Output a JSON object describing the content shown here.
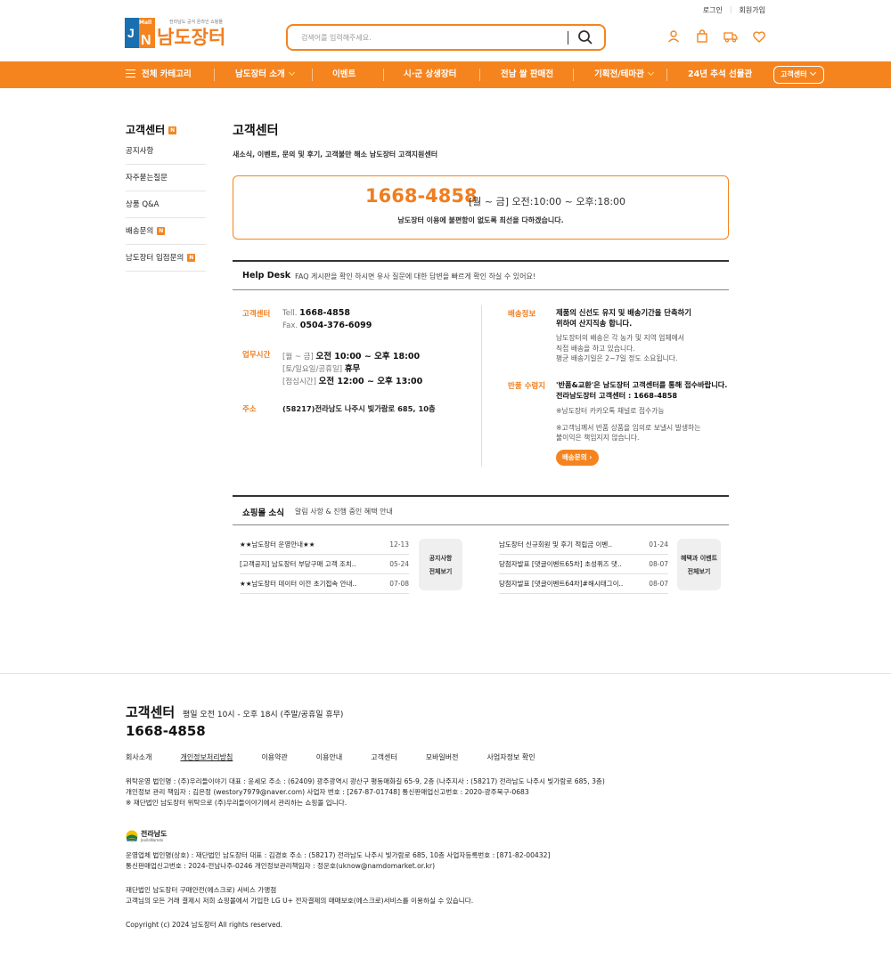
{
  "header": {
    "login": "로그인",
    "signup": "회원가입",
    "logo_text": "남도장터",
    "logo_tag": "전라남도 공식 온라인 쇼핑몰",
    "logo_mark": "Mall",
    "search_placeholder": "검색어를 입력해주세요."
  },
  "nav": {
    "all_category": "전체 카테고리",
    "items": [
      "남도장터 소개",
      "이벤트",
      "시·군 상생장터",
      "전남 쌀 판매전",
      "기획전/테마관",
      "24년 추석 선물관"
    ],
    "cs_button": "고객센터"
  },
  "sidebar": {
    "title": "고객센터",
    "badge": "N",
    "items": [
      "공지사항",
      "자주묻는질문",
      "상품 Q&A",
      "배송문의",
      "남도장터 입점문의"
    ]
  },
  "main": {
    "title": "고객센터",
    "subtitle": "새소식, 이벤트, 문의 및 후기, 고객불만 해소 남도장터 고객지원센터",
    "phone": "1668-4858",
    "hours": "[월 ~ 금] 오전:10:00 ~ 오후:18:00",
    "message": "남도장터 이용에 불편함이 없도록 최선을 다하겠습니다."
  },
  "helpdesk": {
    "title": "Help Desk",
    "desc": "FAQ 게시판을 확인 하시면 유사 질문에 대한 답변을 빠르게 확인 하실 수 있어요!",
    "cs_label": "고객센터",
    "tel_label": "Tell.",
    "tel": "1668-4858",
    "fax_label": "Fax.",
    "fax": "0504-376-6099",
    "work_label": "업무시간",
    "work1_label": "[월 ~ 금]",
    "work1": "오전 10:00 ~ 오후 18:00",
    "work2_label": "[토/일요일/공휴일]",
    "work2": "휴무",
    "work3_label": "[점심시간]",
    "work3": "오전 12:00 ~ 오후 13:00",
    "addr_label": "주소",
    "addr": "(58217)전라남도 나주시 빛가람로 685, 10층",
    "ship_label": "배송정보",
    "ship_title1": "제품의 신선도 유지 및 배송기간을 단축하기",
    "ship_title2": "위하여 산지직송 합니다.",
    "ship_text1": "남도장터의 배송은 각 농가 및 지역 업체에서",
    "ship_text2": "직접 배송을 하고 있습니다.",
    "ship_text3": "평균 배송기일은 2~7일 정도 소요됩니다.",
    "return_label": "반품 수령지",
    "return_title1": "'반품&교환'은 남도장터 고객센터를 통해 접수바랍니다.",
    "return_title2": "전라남도장터 고객센터 : 1668-4858",
    "return_text1": "※남도장터 카카오톡 채널로 접수가능",
    "return_text2": "※고객님께서 반품 상품을 임의로 보낼시 발생하는",
    "return_text3": "불이익은 책임지지 않습니다.",
    "ship_button": "배송문의"
  },
  "news": {
    "title": "쇼핑몰 소식",
    "desc": "알림 사항 & 진행 중인 혜택 안내",
    "notices": [
      {
        "title": "★★남도장터 운영안내★★",
        "date": "12-13"
      },
      {
        "title": "[고객공지] 남도장터 부당구매 고객 조치..",
        "date": "05-24"
      },
      {
        "title": "★★남도장터 데이터 이전 초기접속 안내..",
        "date": "07-08"
      }
    ],
    "notice_btn1": "공지사항",
    "notice_btn2": "전체보기",
    "events": [
      {
        "title": "남도장터 신규회원 및 후기 적립금 이벤..",
        "date": "01-24"
      },
      {
        "title": "당첨자발표 [댓글이벤트65차] 초성퀴즈 댓..",
        "date": "08-07"
      },
      {
        "title": "당첨자발표 [댓글이벤트64차]#해시태그이..",
        "date": "08-07"
      }
    ],
    "event_btn1": "혜택과 이벤트",
    "event_btn2": "전체보기"
  },
  "footer": {
    "cs_title": "고객센터",
    "cs_hours": "평일 오전 10시 - 오후 18시 (주말/공휴일 휴무)",
    "cs_tel": "1668-4858",
    "links": [
      "회사소개",
      "개인정보처리방침",
      "이용약관",
      "이용안내",
      "고객센터",
      "모바일버전",
      "사업자정보 확인"
    ],
    "line1": "위탁운영 법인명 : (주)우리들이야기      대표 : 윤세모      주소 : (62409) 광주광역시 광산구 평동매화길 65-9, 2층 (나주지사 : (58217) 전라남도 나주시 빛가람로 685, 3층)",
    "line2": "개인정보 관리 책임자 : 김은정 (westory7979@naver.com)    사업자 번호 : [267-87-01748]   통신판매업신고번호 : 2020-광주북구-0683",
    "line3": "※ 재단법인 남도장터 위탁으로 (주)우리들이야기에서 관리하는 쇼핑몰 입니다.",
    "jn_logo": "전라남도",
    "jn_logo_en": "JeollaNamdo",
    "line4": "운영업체 법인명(상호) : 재단법인 남도장터      대표 : 김경호      주소 : (58217) 전라남도 나주시 빛가람로 685, 10층      사업자등록번호 : [871-82-00432]",
    "line5": "통신판매업신고번호 : 2024-전남나주-0246      개인정보관리책임자 : 정운호(uknow@namdomarket.or.kr)",
    "line6": "재단법인 남도장터 구매안전(에스크로) 서비스 가맹점",
    "line7": "고객님의 모든 거래 결제시 저희 쇼핑몰에서 가입한 LG U+ 전자결제의 매매보호(에스크로)서비스를 이용하실 수 있습니다.",
    "copyright": "Copyright (c) 2024 남도장터 All rights reserved."
  }
}
